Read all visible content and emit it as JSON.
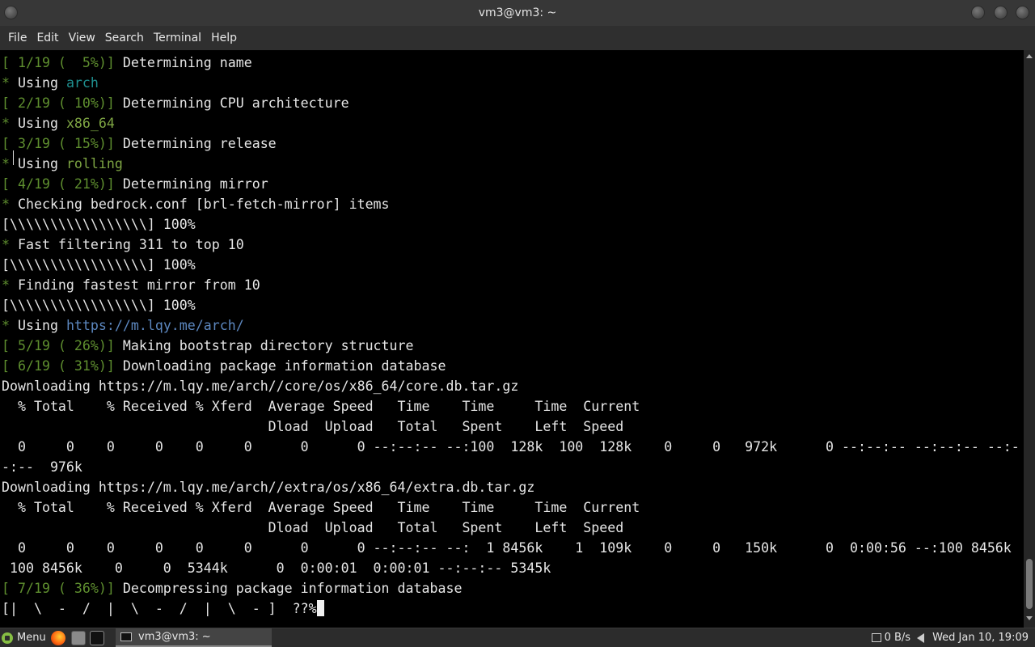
{
  "window": {
    "title": "vm3@vm3: ~"
  },
  "menubar": [
    "File",
    "Edit",
    "View",
    "Search",
    "Terminal",
    "Help"
  ],
  "terminal": {
    "lines": [
      [
        [
          "g",
          "[ 1/19 (  5%)] "
        ],
        [
          "w",
          "Determining name"
        ]
      ],
      [
        [
          "g",
          "* "
        ],
        [
          "w",
          "Using "
        ],
        [
          "c",
          "arch"
        ]
      ],
      [
        [
          "g",
          "[ 2/19 ( 10%)] "
        ],
        [
          "w",
          "Determining CPU architecture"
        ]
      ],
      [
        [
          "g",
          "* "
        ],
        [
          "w",
          "Using "
        ],
        [
          "gb",
          "x86_64"
        ]
      ],
      [
        [
          "g",
          "[ 3/19 ( 15%)] "
        ],
        [
          "w",
          "Determining release"
        ]
      ],
      [
        [
          "g",
          "* "
        ],
        [
          "w",
          "Using "
        ],
        [
          "gb",
          "rolling"
        ]
      ],
      [
        [
          "g",
          "[ 4/19 ( 21%)] "
        ],
        [
          "w",
          "Determining mirror"
        ]
      ],
      [
        [
          "g",
          "* "
        ],
        [
          "w",
          "Checking bedrock.conf [brl-fetch-mirror] items"
        ]
      ],
      [
        [
          "w",
          "[\\\\\\\\\\\\\\\\\\\\\\\\\\\\\\\\\\] 100%"
        ]
      ],
      [
        [
          "g",
          "* "
        ],
        [
          "w",
          "Fast filtering 311 to top 10"
        ]
      ],
      [
        [
          "w",
          "[\\\\\\\\\\\\\\\\\\\\\\\\\\\\\\\\\\] 100%"
        ]
      ],
      [
        [
          "g",
          "* "
        ],
        [
          "w",
          "Finding fastest mirror from 10"
        ]
      ],
      [
        [
          "w",
          "[\\\\\\\\\\\\\\\\\\\\\\\\\\\\\\\\\\] 100%"
        ]
      ],
      [
        [
          "g",
          "* "
        ],
        [
          "w",
          "Using "
        ],
        [
          "b",
          "https://m.lqy.me/arch/"
        ]
      ],
      [
        [
          "g",
          "[ 5/19 ( 26%)] "
        ],
        [
          "w",
          "Making bootstrap directory structure"
        ]
      ],
      [
        [
          "g",
          "[ 6/19 ( 31%)] "
        ],
        [
          "w",
          "Downloading package information database"
        ]
      ],
      [
        [
          "w",
          "Downloading https://m.lqy.me/arch//core/os/x86_64/core.db.tar.gz"
        ]
      ],
      [
        [
          "w",
          "  % Total    % Received % Xferd  Average Speed   Time    Time     Time  Current"
        ]
      ],
      [
        [
          "w",
          "                                 Dload  Upload   Total   Spent    Left  Speed"
        ]
      ],
      [
        [
          "w",
          "  0     0    0     0    0     0      0      0 --:--:-- --:100  128k  100  128k    0     0   972k      0 --:--:-- --:--:-- --:-"
        ]
      ],
      [
        [
          "w",
          "-:--  976k"
        ]
      ],
      [
        [
          "w",
          "Downloading https://m.lqy.me/arch//extra/os/x86_64/extra.db.tar.gz"
        ]
      ],
      [
        [
          "w",
          "  % Total    % Received % Xferd  Average Speed   Time    Time     Time  Current"
        ]
      ],
      [
        [
          "w",
          "                                 Dload  Upload   Total   Spent    Left  Speed"
        ]
      ],
      [
        [
          "w",
          "  0     0    0     0    0     0      0      0 --:--:-- --:  1 8456k    1  109k    0     0   150k      0  0:00:56 --:100 8456k"
        ]
      ],
      [
        [
          "w",
          " 100 8456k    0     0  5344k      0  0:00:01  0:00:01 --:--:-- 5345k"
        ]
      ],
      [
        [
          "g",
          "[ 7/19 ( 36%)] "
        ],
        [
          "w",
          "Decompressing package information database"
        ]
      ],
      [
        [
          "w",
          "[|  \\  -  /  |  \\  -  /  |  \\  - ]  ??%"
        ]
      ]
    ]
  },
  "taskbar": {
    "menu_label": "Menu",
    "task_label": "vm3@vm3: ~",
    "net_speed": "0 B/s",
    "clock": "Wed Jan 10, 19:09"
  }
}
